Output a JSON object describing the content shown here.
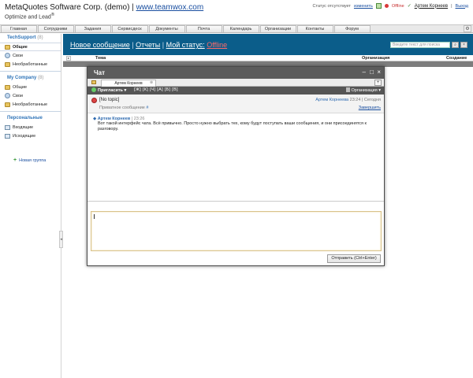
{
  "header": {
    "company": "MetaQuotes Software Corp. (demo)",
    "separator": "|",
    "website": "www.teamwox.com",
    "tagline": "Optimize and Lead",
    "tagline_mark": "®",
    "status_text": "Статус отсутствует",
    "status_change": "изменить",
    "online_status": "Offline",
    "user": "Артем Корнеев",
    "logout": "Выход"
  },
  "tabs": [
    "Главная",
    "Сотрудники",
    "Задания",
    "Сервисдеск",
    "Документы",
    "Почта",
    "Календарь",
    "Организации",
    "Контакты",
    "Форум"
  ],
  "sidebar": {
    "groups": [
      {
        "title": "TechSupport",
        "count": "(8)",
        "items": [
          "Общие",
          "Свои",
          "Необработанные"
        ]
      },
      {
        "title": "My Company",
        "count": "(8)",
        "items": [
          "Общие",
          "Свои",
          "Необработанные"
        ]
      },
      {
        "title": "Персональные",
        "count": "",
        "items": [
          "Входящие",
          "Исходящие"
        ]
      }
    ],
    "new_group": "Новая группа"
  },
  "toolbar": {
    "new_message": "Новое сообщение",
    "sep": "|",
    "reports": "Отчеты",
    "my_status": "Мой статус:",
    "status_value": "Offline",
    "search_placeholder": "Введите текст для поиска"
  },
  "columns": {
    "topic": "Тема",
    "organization": "Организация",
    "created": "Создание"
  },
  "chat": {
    "title": "Чат",
    "tab_label": "Артем Корнеев",
    "invite": "Пригласить",
    "format_buttons": "[Ж] [К] [Ч] [A] [Б] [В]",
    "organization": "Организация",
    "topic": "[No topic]",
    "topic_author": "Артем Корнеева",
    "topic_time": "23:24",
    "topic_day": "Сегодня",
    "private_label": "Приватное сообщение",
    "private_hash": "#",
    "finish": "Завершить",
    "message": {
      "author": "Артем Корнеев",
      "time": "23:26",
      "text": "Вот такой интерфейс чата. Всё привычно. Просто нужно выбрать тех, кому будут поступать ваши сообщения, и они присоединятся к разговору."
    },
    "send": "Отправить (Ctrl+Enter)"
  }
}
